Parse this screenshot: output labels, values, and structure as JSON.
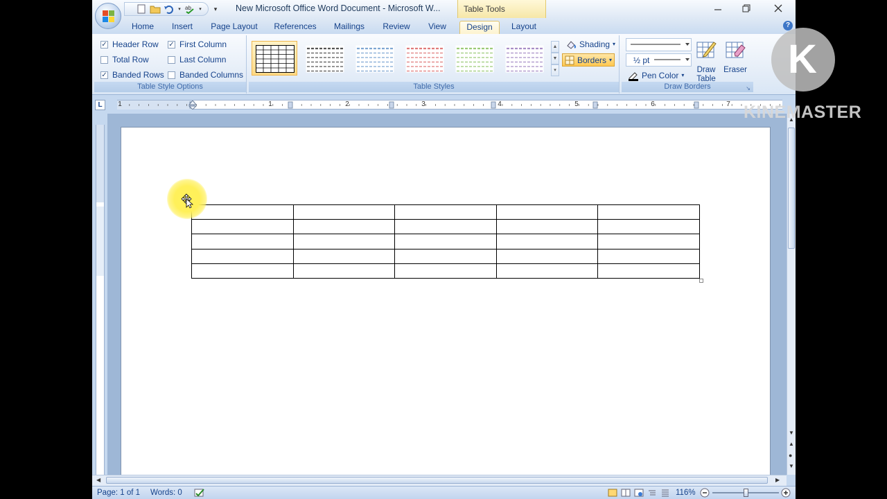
{
  "window": {
    "title": "New Microsoft Office Word Document - Microsoft W...",
    "contextual_tab_group": "Table Tools"
  },
  "tabs": [
    {
      "label": "Home",
      "active": false
    },
    {
      "label": "Insert",
      "active": false
    },
    {
      "label": "Page Layout",
      "active": false
    },
    {
      "label": "References",
      "active": false
    },
    {
      "label": "Mailings",
      "active": false
    },
    {
      "label": "Review",
      "active": false
    },
    {
      "label": "View",
      "active": false
    },
    {
      "label": "Design",
      "active": true
    },
    {
      "label": "Layout",
      "active": false
    }
  ],
  "ribbon": {
    "table_style_options": {
      "label": "Table Style Options",
      "options": [
        {
          "label": "Header Row",
          "checked": true
        },
        {
          "label": "Total Row",
          "checked": false
        },
        {
          "label": "Banded Rows",
          "checked": true
        },
        {
          "label": "First Column",
          "checked": true
        },
        {
          "label": "Last Column",
          "checked": false
        },
        {
          "label": "Banded Columns",
          "checked": false
        }
      ]
    },
    "table_styles": {
      "label": "Table Styles",
      "swatches": [
        "#000000",
        "#555555",
        "#7fa7d3",
        "#e07c7c",
        "#9ccb78",
        "#a88fc7"
      ],
      "shading_label": "Shading",
      "borders_label": "Borders"
    },
    "draw_borders": {
      "label": "Draw Borders",
      "line_weight": "½ pt",
      "pen_color_label": "Pen Color",
      "draw_table_label": "Draw Table",
      "eraser_label": "Eraser"
    }
  },
  "ruler": {
    "numbers": [
      "1",
      "1",
      "2",
      "3",
      "4",
      "5",
      "6",
      "7"
    ],
    "corner_symbol": "L"
  },
  "document": {
    "table": {
      "rows": 5,
      "columns": 5
    }
  },
  "status_bar": {
    "page": "Page: 1 of 1",
    "words": "Words: 0",
    "zoom": "116%"
  },
  "watermark": {
    "text": "KINEMASTER",
    "logo_letter": "K"
  }
}
